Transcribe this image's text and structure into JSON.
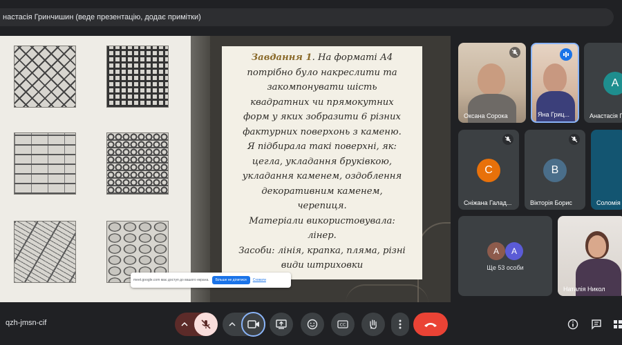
{
  "banner": {
    "text": "настасія Гринчишин (веде презентацію, додає примітки)"
  },
  "slide": {
    "task_label": "Завдання 1",
    "lines": [
      ". На форматі А4",
      "потрібно було накреслити та",
      "закомпонувати шість",
      "квадратних чи прямокутних",
      "форм у яких зобразити 6 різних",
      "фактурних поверхонь з каменю.",
      "Я підбирала такі  поверхні, як:",
      "цегла, укладання бруківкою,",
      "укладання каменем, оздоблення",
      "декоративним каменем,",
      "черепиця.",
      "Матеріали використовувала:",
      "лінер.",
      "Засоби: лінія, крапка, пляма, різні",
      "види штриховки"
    ]
  },
  "share_notice": {
    "text": "meet.google.com має доступ до вашого екрана.",
    "stop_label": "Більше не ділитися",
    "hide_label": "Сховати"
  },
  "participants": [
    {
      "name": "Оксана Сорока",
      "mic": "off"
    },
    {
      "name": "Яна Гриц...",
      "mic": "speaking"
    },
    {
      "name": "Анастасія Гр",
      "initial": "А",
      "color": "#1e8e8e"
    },
    {
      "name": "Сніжана Галад...",
      "initial": "С",
      "color": "#e8710a",
      "mic": "off"
    },
    {
      "name": "Вікторія Борис",
      "initial": "В",
      "color": "#4a6e8a",
      "mic": "off"
    },
    {
      "name": "Соломія",
      "color": "#135571",
      "mic": "off"
    },
    {
      "name": "Наталія Никол"
    }
  ],
  "others": {
    "label": "Ще 53 особи",
    "avatars": [
      "А",
      "А"
    ],
    "colors": [
      "#8d5b4c",
      "#5b5bd6"
    ]
  },
  "meeting_code": "qzh-jmsn-cif",
  "colors": {
    "end_call": "#ea4335",
    "mic_off_bg": "#f9dedc",
    "accent": "#8ab4f8"
  }
}
